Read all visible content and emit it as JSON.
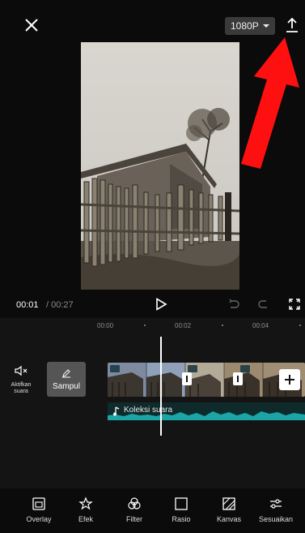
{
  "top_bar": {
    "resolution_label": "1080P"
  },
  "playback": {
    "current_time": "00:01",
    "total_time": "/ 00:27"
  },
  "timeline": {
    "ruler_labels": [
      "00:00",
      "00:02",
      "00:04"
    ],
    "audio_toggle_label": "Aktifkan suara",
    "cover_label": "Sampul",
    "audio_track_label": "Koleksi suara"
  },
  "toolbar": {
    "items": [
      {
        "label": "Overlay",
        "icon": "overlay-icon"
      },
      {
        "label": "Efek",
        "icon": "effects-icon"
      },
      {
        "label": "Filter",
        "icon": "filter-icon"
      },
      {
        "label": "Rasio",
        "icon": "ratio-icon"
      },
      {
        "label": "Kanvas",
        "icon": "canvas-icon"
      },
      {
        "label": "Sesuaikan",
        "icon": "adjust-icon"
      }
    ]
  },
  "colors": {
    "background": "#0b0b0b",
    "timeline_bg": "#141414",
    "waveform": "#1aa6a6",
    "annotation_arrow": "#ff1010"
  }
}
